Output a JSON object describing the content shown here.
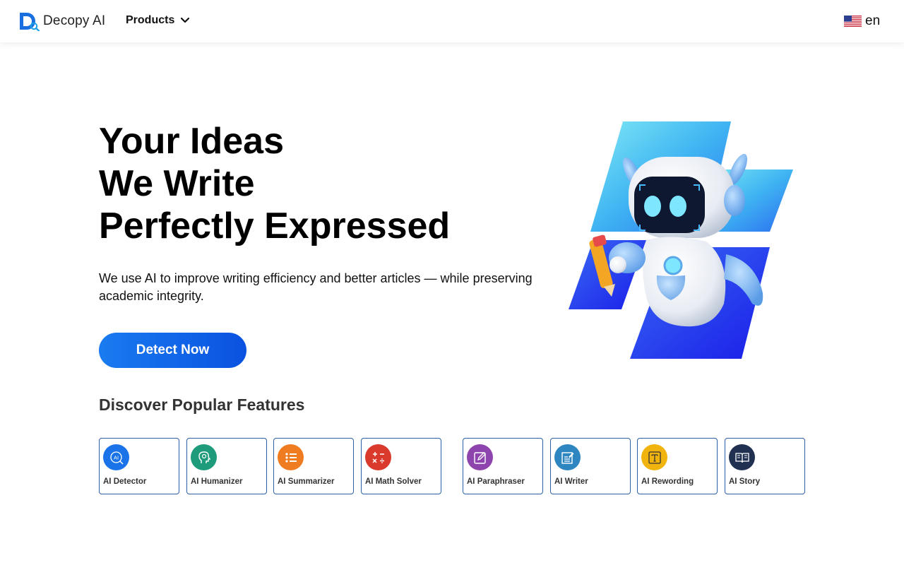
{
  "header": {
    "logo_text": "Decopy AI",
    "products_label": "Products",
    "language": "en"
  },
  "hero": {
    "lines": [
      "Your Ideas",
      "We Write",
      "Perfectly Expressed"
    ],
    "description": "We use AI to improve writing efficiency and better articles — while preserving academic integrity.",
    "cta_label": "Detect Now"
  },
  "features": {
    "title": "Discover Popular Features",
    "items": [
      {
        "label": "AI Detector",
        "icon": "ai-detector-icon",
        "color": "#1a73e8"
      },
      {
        "label": "AI Humanizer",
        "icon": "humanizer-icon",
        "color": "#1e9b7b"
      },
      {
        "label": "AI Summarizer",
        "icon": "list-icon",
        "color": "#f07c22"
      },
      {
        "label": "AI Math Solver",
        "icon": "calculator-icon",
        "color": "#d93a2b"
      },
      {
        "label": "AI Paraphraser",
        "icon": "edit-icon",
        "color": "#8e44ad"
      },
      {
        "label": "AI Writer",
        "icon": "document-icon",
        "color": "#2e86c1"
      },
      {
        "label": "AI Rewording",
        "icon": "text-icon",
        "color": "#f1b40f"
      },
      {
        "label": "AI Story",
        "icon": "book-icon",
        "color": "#1f3050"
      }
    ]
  }
}
